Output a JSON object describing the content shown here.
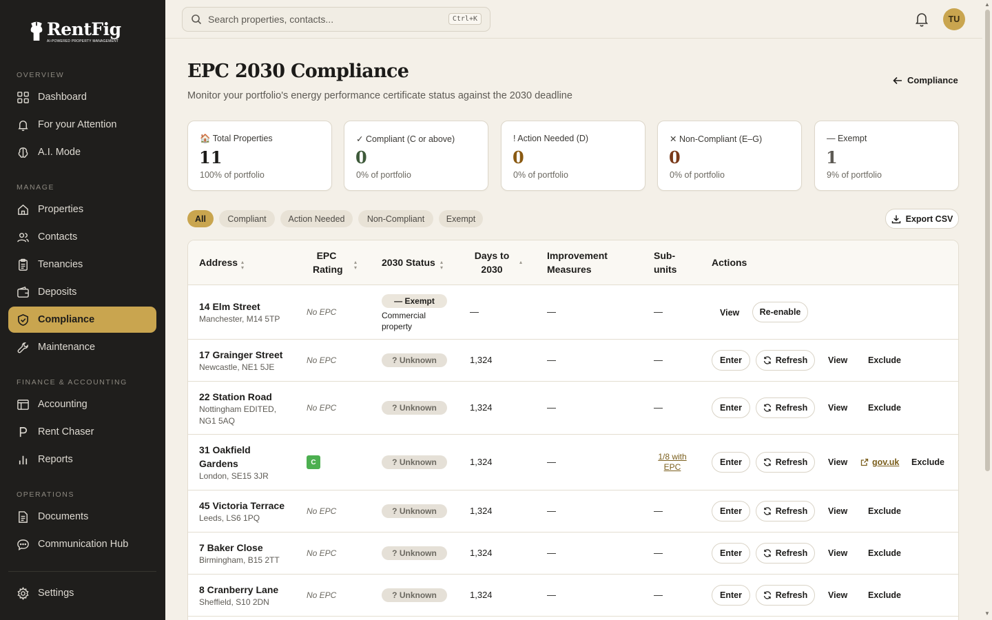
{
  "app": {
    "logo_name": "RentFig",
    "logo_tagline": "AI-POWERED PROPERTY MANAGEMENT"
  },
  "sidebar": {
    "sections": [
      "OVERVIEW",
      "MANAGE",
      "FINANCE & ACCOUNTING",
      "OPERATIONS"
    ],
    "items": [
      {
        "label": "Dashboard",
        "icon": "grid-icon"
      },
      {
        "label": "For your Attention",
        "icon": "bell-icon"
      },
      {
        "label": "A.I. Mode",
        "icon": "brain-icon"
      },
      {
        "label": "Properties",
        "icon": "home-icon"
      },
      {
        "label": "Contacts",
        "icon": "users-icon"
      },
      {
        "label": "Tenancies",
        "icon": "clipboard-icon"
      },
      {
        "label": "Deposits",
        "icon": "wallet-icon"
      },
      {
        "label": "Compliance",
        "icon": "shield-check-icon"
      },
      {
        "label": "Maintenance",
        "icon": "wrench-icon"
      },
      {
        "label": "Accounting",
        "icon": "calculator-icon"
      },
      {
        "label": "Rent Chaser",
        "icon": "letter-p-icon"
      },
      {
        "label": "Reports",
        "icon": "bar-chart-icon"
      },
      {
        "label": "Documents",
        "icon": "document-icon"
      },
      {
        "label": "Communication Hub",
        "icon": "chat-icon"
      },
      {
        "label": "Settings",
        "icon": "gear-icon"
      }
    ],
    "active": "Compliance",
    "active_color": "#c9a54f"
  },
  "topbar": {
    "search_placeholder": "Search properties, contacts...",
    "shortcut": "Ctrl+K",
    "avatar_initials": "TU"
  },
  "page": {
    "title": "EPC 2030 Compliance",
    "subtitle": "Monitor your portfolio's energy performance certificate status against the 2030 deadline",
    "back_label": "Compliance"
  },
  "cards": [
    {
      "label": "🏠 Total Properties",
      "value": "11",
      "sub": "100% of portfolio",
      "color": "#1c1b19"
    },
    {
      "label": "✓ Compliant (C or above)",
      "value": "0",
      "sub": "0% of portfolio",
      "color": "#3e5a3a"
    },
    {
      "label": "! Action Needed (D)",
      "value": "0",
      "sub": "0% of portfolio",
      "color": "#8a5a12"
    },
    {
      "label": "✕ Non-Compliant (E–G)",
      "value": "0",
      "sub": "0% of portfolio",
      "color": "#7a3a1a"
    },
    {
      "label": "— Exempt",
      "value": "1",
      "sub": "9% of portfolio",
      "color": "#5d5a54"
    }
  ],
  "filters": [
    "All",
    "Compliant",
    "Action Needed",
    "Non-Compliant",
    "Exempt"
  ],
  "active_filter": "All",
  "export_label": "Export CSV",
  "table": {
    "headers": {
      "address": "Address",
      "epc_1": "EPC",
      "epc_2": "Rating",
      "status": "2030 Status",
      "days_1": "Days to",
      "days_2": "2030",
      "improve_1": "Improvement",
      "improve_2": "Measures",
      "sub_1": "Sub-",
      "sub_2": "units",
      "actions": "Actions"
    },
    "rows": [
      {
        "name": "14 Elm Street",
        "city": "Manchester, M14 5TP",
        "epc": "No EPC",
        "status": "— Exempt",
        "note_1": "Commercial",
        "note_2": "property",
        "days": "—",
        "measures": "—",
        "subunits": "—",
        "actions": [
          "View",
          "Re-enable"
        ]
      },
      {
        "name": "17 Grainger Street",
        "city": "Newcastle, NE1 5JE",
        "epc": "No EPC",
        "status": "? Unknown",
        "days": "1,324",
        "measures": "—",
        "subunits": "—",
        "actions": [
          "Enter",
          "Refresh",
          "View",
          "Exclude"
        ]
      },
      {
        "name": "22 Station Road",
        "city_1": "Nottingham EDITED,",
        "city_2": "NG1 5AQ",
        "epc": "No EPC",
        "status": "? Unknown",
        "days": "1,324",
        "measures": "—",
        "subunits": "—",
        "actions": [
          "Enter",
          "Refresh",
          "View",
          "Exclude"
        ]
      },
      {
        "name_1": "31 Oakfield",
        "name_2": "Gardens",
        "city": "London, SE15 3JR",
        "epc": "C",
        "status": "? Unknown",
        "days": "1,324",
        "measures": "—",
        "subunits_1": "1/8 with",
        "subunits_2": "EPC",
        "actions": [
          "Enter",
          "Refresh",
          "View",
          "gov.uk",
          "Exclude"
        ]
      },
      {
        "name": "45 Victoria Terrace",
        "city": "Leeds, LS6 1PQ",
        "epc": "No EPC",
        "status": "? Unknown",
        "days": "1,324",
        "measures": "—",
        "subunits": "—",
        "actions": [
          "Enter",
          "Refresh",
          "View",
          "Exclude"
        ]
      },
      {
        "name": "7 Baker Close",
        "city": "Birmingham, B15 2TT",
        "epc": "No EPC",
        "status": "? Unknown",
        "days": "1,324",
        "measures": "—",
        "subunits": "—",
        "actions": [
          "Enter",
          "Refresh",
          "View",
          "Exclude"
        ]
      },
      {
        "name": "8 Cranberry Lane",
        "city": "Sheffield, S10 2DN",
        "epc": "No EPC",
        "status": "? Unknown",
        "days": "1,324",
        "measures": "—",
        "subunits": "—",
        "actions": [
          "Enter",
          "Refresh",
          "View",
          "Exclude"
        ]
      }
    ]
  }
}
